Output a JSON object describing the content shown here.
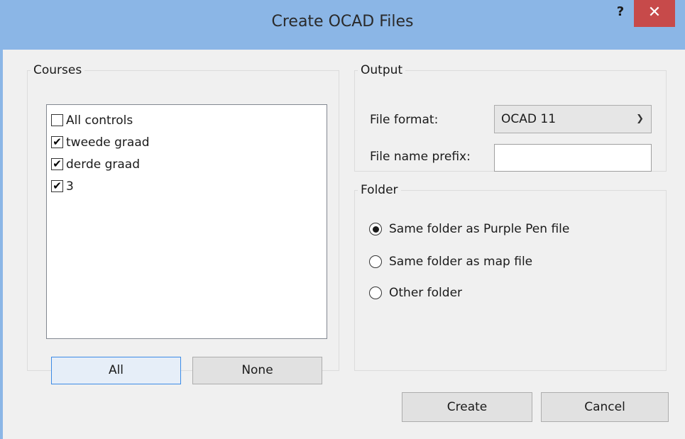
{
  "window": {
    "title": "Create OCAD Files",
    "help_glyph": "?",
    "close_glyph": "✕"
  },
  "courses": {
    "legend": "Courses",
    "items": [
      {
        "label": "All controls",
        "checked": false
      },
      {
        "label": "tweede graad",
        "checked": true
      },
      {
        "label": "derde graad",
        "checked": true
      },
      {
        "label": "3",
        "checked": true
      }
    ],
    "all_label": "All",
    "none_label": "None"
  },
  "output": {
    "legend": "Output",
    "file_format_label": "File format:",
    "file_format_value": "OCAD 11",
    "file_prefix_label": "File name prefix:",
    "file_prefix_value": ""
  },
  "folder": {
    "legend": "Folder",
    "options": [
      {
        "label": "Same folder as Purple Pen file",
        "selected": true
      },
      {
        "label": "Same folder as map file",
        "selected": false
      },
      {
        "label": "Other folder",
        "selected": false
      }
    ]
  },
  "actions": {
    "create_label": "Create",
    "cancel_label": "Cancel"
  },
  "colors": {
    "titlebar": "#8bb6e6",
    "close_button": "#c74a4a",
    "dialog_bg": "#f0f0f0"
  }
}
